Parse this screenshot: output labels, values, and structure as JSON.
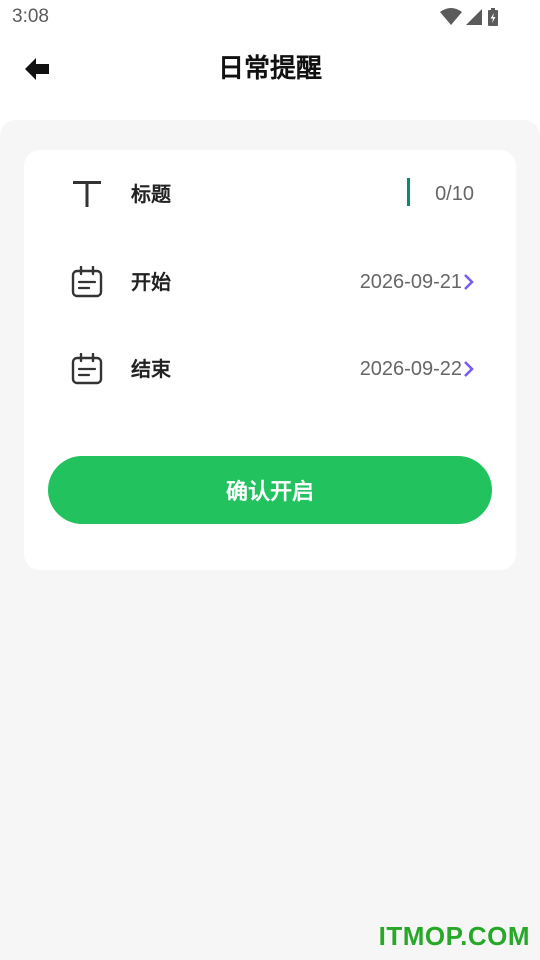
{
  "status_bar": {
    "time": "3:08",
    "icons": [
      "wifi-icon",
      "signal-icon",
      "battery-charging-icon"
    ]
  },
  "header": {
    "title": "日常提醒",
    "back_icon": "arrow-left-icon"
  },
  "form": {
    "title_row": {
      "label": "标题",
      "counter": "0/10",
      "icon": "text-t-icon"
    },
    "start_row": {
      "label": "开始",
      "value": "2026-09-21",
      "icon": "calendar-icon"
    },
    "end_row": {
      "label": "结束",
      "value": "2026-09-22",
      "icon": "calendar-icon"
    },
    "confirm_label": "确认开启"
  },
  "watermark": "ITMOP.COM",
  "colors": {
    "accent_green": "#22c35e",
    "cursor_teal": "#0a8a74",
    "chevron_purple": "#7b5cf0",
    "content_bg": "#f6f6f6"
  }
}
